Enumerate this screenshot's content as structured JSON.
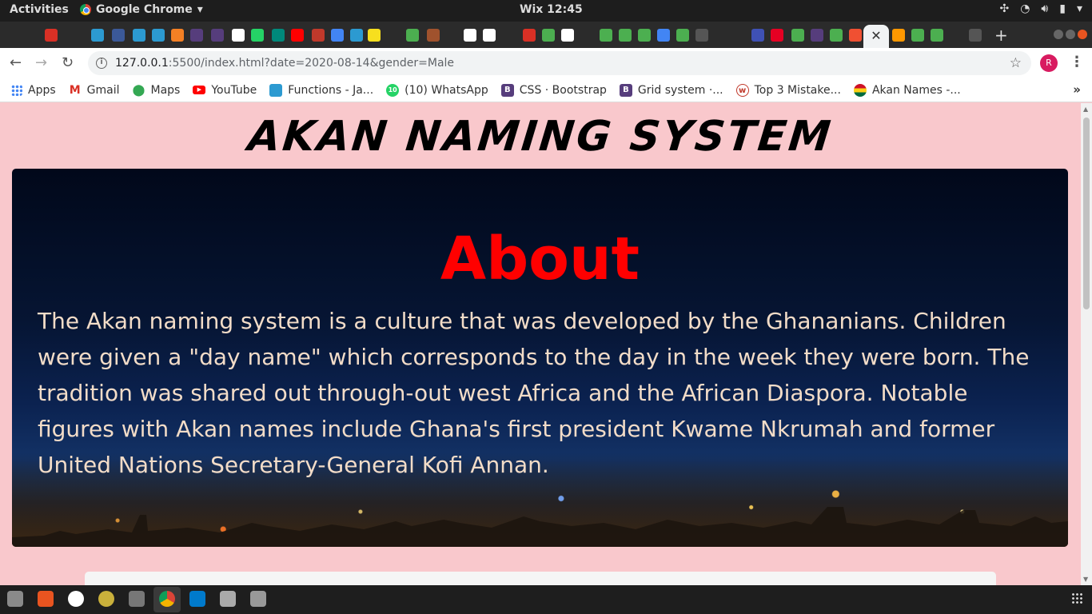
{
  "topbar": {
    "activities": "Activities",
    "app_name": "Google Chrome",
    "clock": "Wix 12:45"
  },
  "browser": {
    "url_host": "127.0.0.1",
    "url_rest": ":5500/index.html?date=2020-08-14&gender=Male",
    "profile_initial": "R",
    "close_tab_glyph": "✕",
    "new_tab_glyph": "+"
  },
  "bookmarks": [
    {
      "label": "Apps",
      "icon": "apps-grid-icon",
      "color": "#4285f4"
    },
    {
      "label": "Gmail",
      "icon": "gmail-icon",
      "color": "#d93025"
    },
    {
      "label": "Maps",
      "icon": "maps-pin-icon",
      "color": "#34a853"
    },
    {
      "label": "YouTube",
      "icon": "youtube-icon",
      "color": "#ff0000"
    },
    {
      "label": "Functions - Ja...",
      "icon": "functions-icon",
      "color": "#2c9ad1"
    },
    {
      "label": "(10) WhatsApp",
      "icon": "whatsapp-icon",
      "color": "#25d366"
    },
    {
      "label": "CSS · Bootstrap",
      "icon": "bootstrap-icon",
      "color": "#563d7c"
    },
    {
      "label": "Grid system ·...",
      "icon": "bootstrap-icon",
      "color": "#563d7c"
    },
    {
      "label": "Top 3 Mistake...",
      "icon": "w-icon",
      "color": "#c0392b"
    },
    {
      "label": "Akan Names -...",
      "icon": "ghana-flag-icon",
      "color": "#ce1126"
    }
  ],
  "page": {
    "site_title": "AKAN NAMING SYSTEM",
    "about_heading": "About",
    "about_text": "The Akan naming system is a culture that was developed by the Ghananians. Children were given a \"day name\" which corresponds to the day in the week they were born. The tradition was shared out through-out west Africa and the African Diaspora. Notable figures with Akan names include Ghana's first president Kwame Nkrumah and former United Nations Secretary-General Kofi Annan."
  },
  "colors": {
    "page_bg": "#f9c8cc",
    "heading_red": "#ff0000",
    "body_text": "#f2dcc8"
  }
}
